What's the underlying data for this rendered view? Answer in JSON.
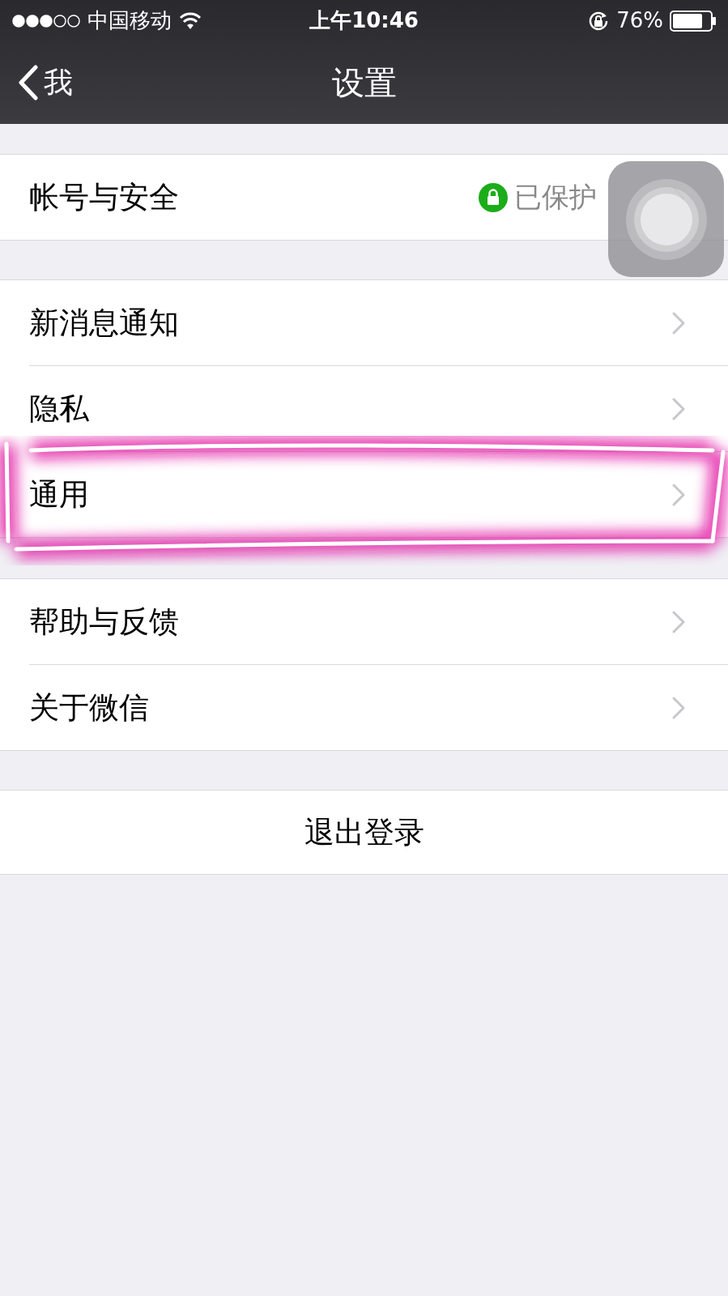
{
  "status_bar": {
    "carrier": "中国移动",
    "time": "上午10:46",
    "battery": "76%"
  },
  "nav": {
    "back_label": "我",
    "title": "设置"
  },
  "groups": [
    {
      "items": [
        {
          "label": "帐号与安全",
          "value": "已保护",
          "kind": "status",
          "highlighted": false
        }
      ]
    },
    {
      "items": [
        {
          "label": "新消息通知",
          "kind": "plain",
          "highlighted": false
        },
        {
          "label": "隐私",
          "kind": "plain",
          "highlighted": false
        },
        {
          "label": "通用",
          "kind": "plain",
          "highlighted": true
        }
      ]
    },
    {
      "items": [
        {
          "label": "帮助与反馈",
          "kind": "plain",
          "highlighted": false
        },
        {
          "label": "关于微信",
          "kind": "plain",
          "highlighted": false
        }
      ]
    }
  ],
  "logout": "退出登录"
}
